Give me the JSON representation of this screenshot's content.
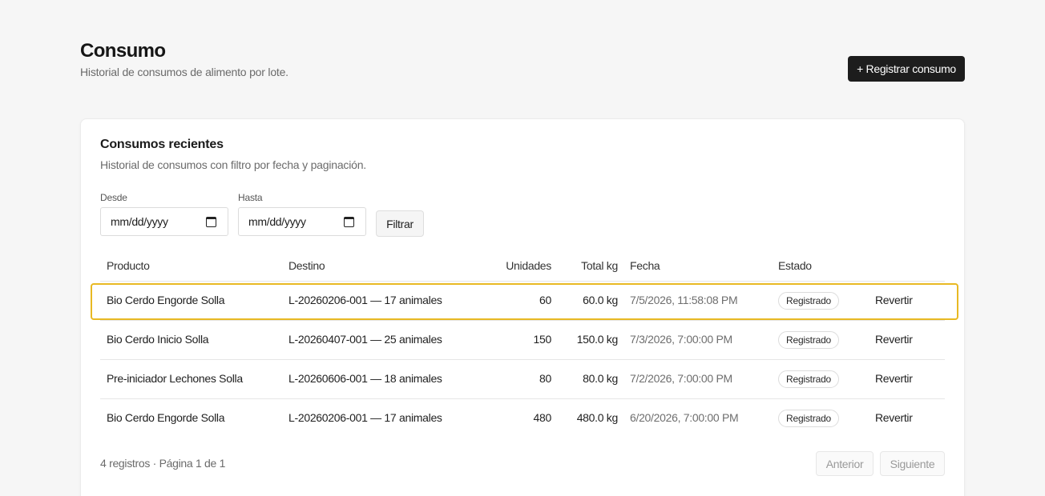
{
  "header": {
    "title": "Consumo",
    "subtitle": "Historial de consumos de alimento por lote.",
    "primary_button": "+ Registrar consumo"
  },
  "card": {
    "title": "Consumos recientes",
    "subtitle": "Historial de consumos con filtro por fecha y paginación."
  },
  "filters": {
    "from_label": "Desde",
    "from_value": "mm/dd/yyyy",
    "to_label": "Hasta",
    "to_value": "mm/dd/yyyy",
    "filter_button": "Filtrar"
  },
  "table": {
    "columns": [
      "Producto",
      "Destino",
      "Unidades",
      "Total kg",
      "Fecha",
      "Estado"
    ],
    "rows": [
      {
        "producto": "Bio Cerdo Engorde Solla",
        "destino": "L-20260206-001 — 17 animales",
        "unidades": "60",
        "total": "60.0 kg",
        "fecha": "7/5/2026, 11:58:08 PM",
        "estado": "Registrado",
        "accion": "Revertir"
      },
      {
        "producto": "Bio Cerdo Inicio Solla",
        "destino": "L-20260407-001 — 25 animales",
        "unidades": "150",
        "total": "150.0 kg",
        "fecha": "7/3/2026, 7:00:00 PM",
        "estado": "Registrado",
        "accion": "Revertir"
      },
      {
        "producto": "Pre-iniciador Lechones Solla",
        "destino": "L-20260606-001 — 18 animales",
        "unidades": "80",
        "total": "80.0 kg",
        "fecha": "7/2/2026, 7:00:00 PM",
        "estado": "Registrado",
        "accion": "Revertir"
      },
      {
        "producto": "Bio Cerdo Engorde Solla",
        "destino": "L-20260206-001 — 17 animales",
        "unidades": "480",
        "total": "480.0 kg",
        "fecha": "6/20/2026, 7:00:00 PM",
        "estado": "Registrado",
        "accion": "Revertir"
      }
    ]
  },
  "pagination": {
    "summary": "4 registros · Página 1 de 1",
    "prev": "Anterior",
    "next": "Siguiente"
  },
  "colors": {
    "highlight": "#e8b923",
    "primary": "#1d1d1d",
    "background": "#f6f6f6"
  }
}
